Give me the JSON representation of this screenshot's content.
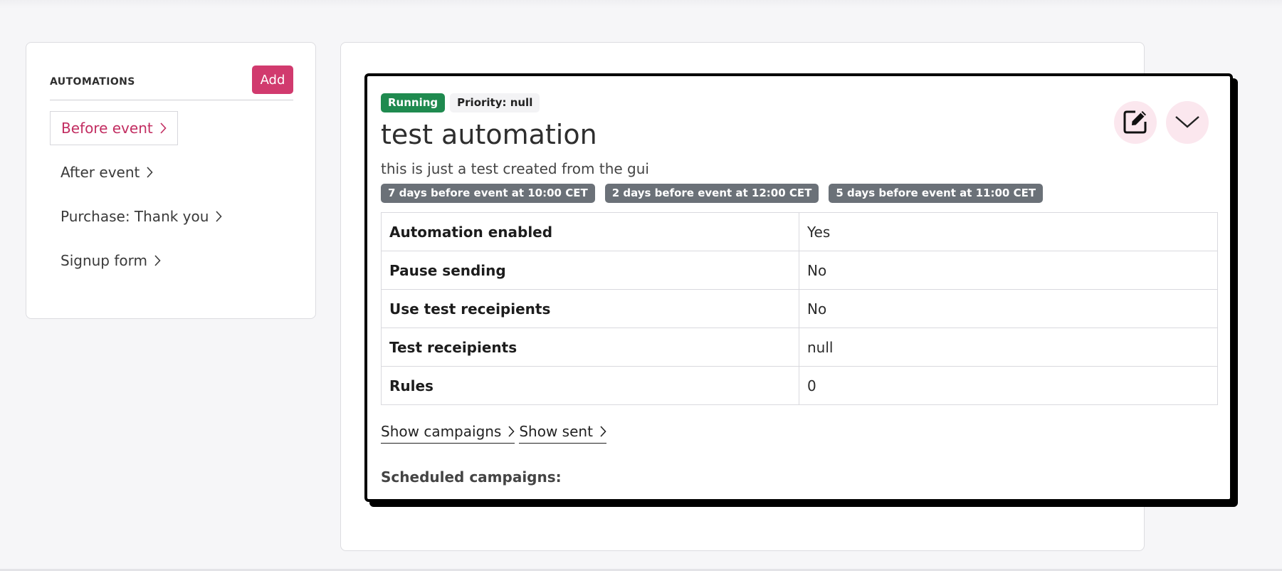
{
  "sidebar": {
    "title": "AUTOMATIONS",
    "add_label": "Add",
    "items": [
      {
        "label": "Before event"
      },
      {
        "label": "After event"
      },
      {
        "label": "Purchase: Thank you"
      },
      {
        "label": "Signup form"
      }
    ]
  },
  "automation": {
    "status": "Running",
    "priority": "Priority: null",
    "title": "test automation",
    "description": "this is just a test created from the gui",
    "schedules": [
      "7 days before event at 10:00 CET",
      "2 days before event at 12:00 CET",
      "5 days before event at 11:00 CET"
    ],
    "details": [
      {
        "key": "Automation enabled",
        "value": "Yes"
      },
      {
        "key": "Pause sending",
        "value": "No"
      },
      {
        "key": "Use test receipients",
        "value": "No"
      },
      {
        "key": "Test receipients",
        "value": "null"
      },
      {
        "key": "Rules",
        "value": "0"
      }
    ],
    "show_campaigns_label": "Show campaigns",
    "show_sent_label": "Show sent",
    "scheduled_campaigns_label": "Scheduled campaigns:",
    "edit_icon": "edit-icon",
    "collapse_icon": "chevron-down-icon"
  },
  "colors": {
    "accent": "#d13a6e",
    "running": "#1f8a4f",
    "tag": "#6b7178"
  }
}
